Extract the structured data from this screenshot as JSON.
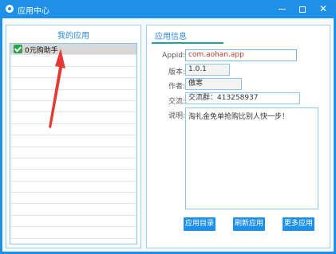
{
  "window": {
    "title": "应用中心",
    "controls": {
      "minimize_icon": "minimize-icon",
      "maximize_icon": "maximize-icon",
      "close_icon": "close-icon",
      "close_glyph": "✕"
    }
  },
  "left_panel": {
    "title": "我的应用",
    "items": [
      {
        "label": "0元购助手",
        "checked": true,
        "selected": true
      }
    ],
    "empty_row_count": 16
  },
  "right_panel": {
    "tab": "应用信息",
    "fields": {
      "appid": {
        "label": "Appid:",
        "value": "com.aohan.app"
      },
      "version": {
        "label": "版本:",
        "value": "1.0.1"
      },
      "author": {
        "label": "作者:",
        "value": "傲寒"
      },
      "contact": {
        "label": "交流:",
        "value": "交流群：413258937"
      },
      "description": {
        "label": "说明:",
        "value": "淘礼金免单抢购比别人快一步！"
      }
    },
    "buttons": {
      "catalog": "应用目录",
      "refresh": "刷新应用",
      "more": "更多应用"
    }
  },
  "colors": {
    "titlebar": "#1e90e8",
    "accent": "#2d8ad8",
    "arrow": "#e53935",
    "checkbox": "#2aa24a"
  }
}
